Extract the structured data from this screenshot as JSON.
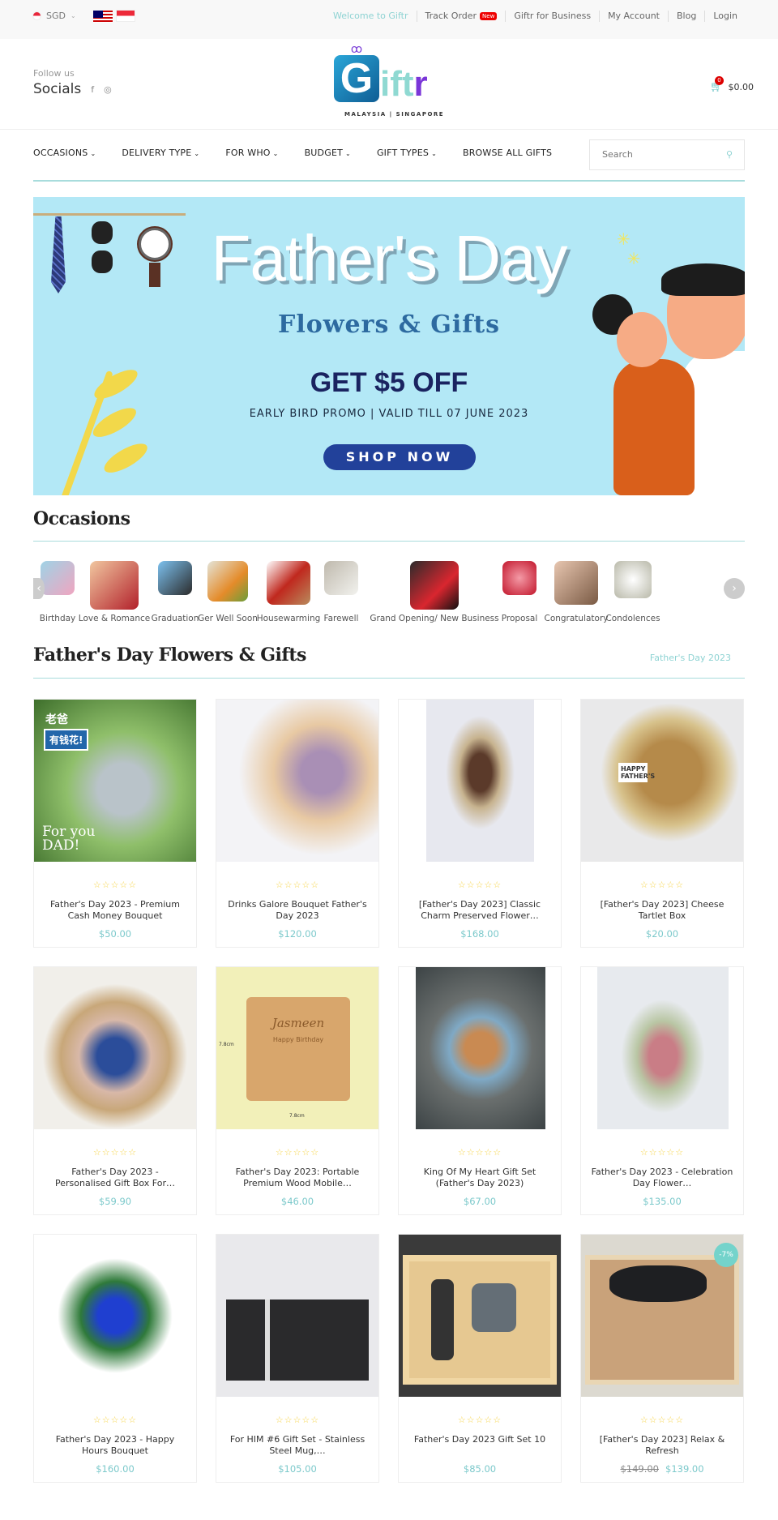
{
  "topbar": {
    "currency": "SGD",
    "currency_icon": "singapore-flag-icon",
    "flags": [
      "malaysia-flag-icon",
      "singapore-flag-icon"
    ],
    "links": [
      {
        "label": "Welcome to Giftr"
      },
      {
        "label": "Track Order",
        "badge": "New"
      },
      {
        "label": "Giftr for Business"
      },
      {
        "label": "My Account"
      },
      {
        "label": "Blog"
      },
      {
        "label": "Login"
      }
    ]
  },
  "header": {
    "follow_label": "Follow us",
    "socials_label": "Socials",
    "social_icons": [
      "facebook-icon",
      "instagram-icon"
    ],
    "logo": {
      "g": "G",
      "text": "ift",
      "r": "r",
      "subtitle": "MALAYSIA | SINGAPORE"
    },
    "cart": {
      "count": "0",
      "total": "$0.00"
    }
  },
  "nav": {
    "items": [
      {
        "label": "OCCASIONS",
        "has_dropdown": true
      },
      {
        "label": "DELIVERY TYPE",
        "has_dropdown": true
      },
      {
        "label": "FOR WHO",
        "has_dropdown": true
      },
      {
        "label": "BUDGET",
        "has_dropdown": true
      },
      {
        "label": "GIFT TYPES",
        "has_dropdown": true
      },
      {
        "label": "BROWSE ALL GIFTS",
        "has_dropdown": false
      }
    ],
    "search_placeholder": "Search"
  },
  "banner": {
    "title": "Father's Day",
    "subtitle": "Flowers & Gifts",
    "offer": "GET $5 OFF",
    "promo": "EARLY BIRD PROMO | VALID TILL 07 JUNE 2023",
    "cta": "SHOP NOW",
    "colors": {
      "background": "#b3e8f6",
      "cta": "#22419a",
      "offer": "#1a2360"
    }
  },
  "occasions": {
    "title": "Occasions",
    "items": [
      {
        "label": "Birthday"
      },
      {
        "label": "Love & Romance"
      },
      {
        "label": "Graduation"
      },
      {
        "label": "Ger Well Soon"
      },
      {
        "label": "Housewarming"
      },
      {
        "label": "Farewell"
      },
      {
        "label": "Grand Opening/ New Business"
      },
      {
        "label": "Proposal"
      },
      {
        "label": "Congratulatory"
      },
      {
        "label": "Condolences"
      }
    ]
  },
  "products_section": {
    "title": "Father's Day Flowers & Gifts",
    "link": "Father's Day 2023",
    "rating_stars": "☆☆☆☆☆",
    "products": [
      {
        "name": "Father's Day 2023 - Premium Cash Money Bouquet",
        "price": "$50.00",
        "image_text": [
          "老爸",
          "有钱花!",
          "For you DAD!"
        ]
      },
      {
        "name": "Drinks Galore Bouquet Father's Day 2023",
        "price": "$120.00"
      },
      {
        "name": "[Father's Day 2023] Classic Charm Preserved Flower…",
        "price": "$168.00"
      },
      {
        "name": "[Father's Day 2023] Cheese Tartlet Box",
        "price": "$20.00",
        "image_text": [
          "HAPPY FATHER'S"
        ]
      },
      {
        "name": "Father's Day 2023 - Personalised Gift Box For…",
        "price": "$59.90"
      },
      {
        "name": "Father's Day 2023: Portable Premium Wood Mobile…",
        "price": "$46.00",
        "image_text": [
          "Jasmeen",
          "Happy Birthday",
          "7.8cm",
          "7.8cm"
        ]
      },
      {
        "name": "King Of My Heart Gift Set (Father's Day 2023)",
        "price": "$67.00"
      },
      {
        "name": "Father's Day 2023 - Celebration Day Flower…",
        "price": "$135.00"
      },
      {
        "name": "Father's Day 2023 - Happy Hours Bouquet",
        "price": "$160.00"
      },
      {
        "name": "For HIM #6 Gift Set - Stainless Steel Mug,…",
        "price": "$105.00"
      },
      {
        "name": "Father's Day 2023 Gift Set 10",
        "price": "$85.00"
      },
      {
        "name": "[Father's Day 2023] Relax & Refresh",
        "price": "$139.00",
        "old_price": "$149.00",
        "sale_badge": "-7%"
      }
    ]
  },
  "theme": {
    "accent": "#8ed3d3",
    "price": "#7cc9cb",
    "star": "#f6d44a",
    "badge_red": "#dd0000"
  }
}
